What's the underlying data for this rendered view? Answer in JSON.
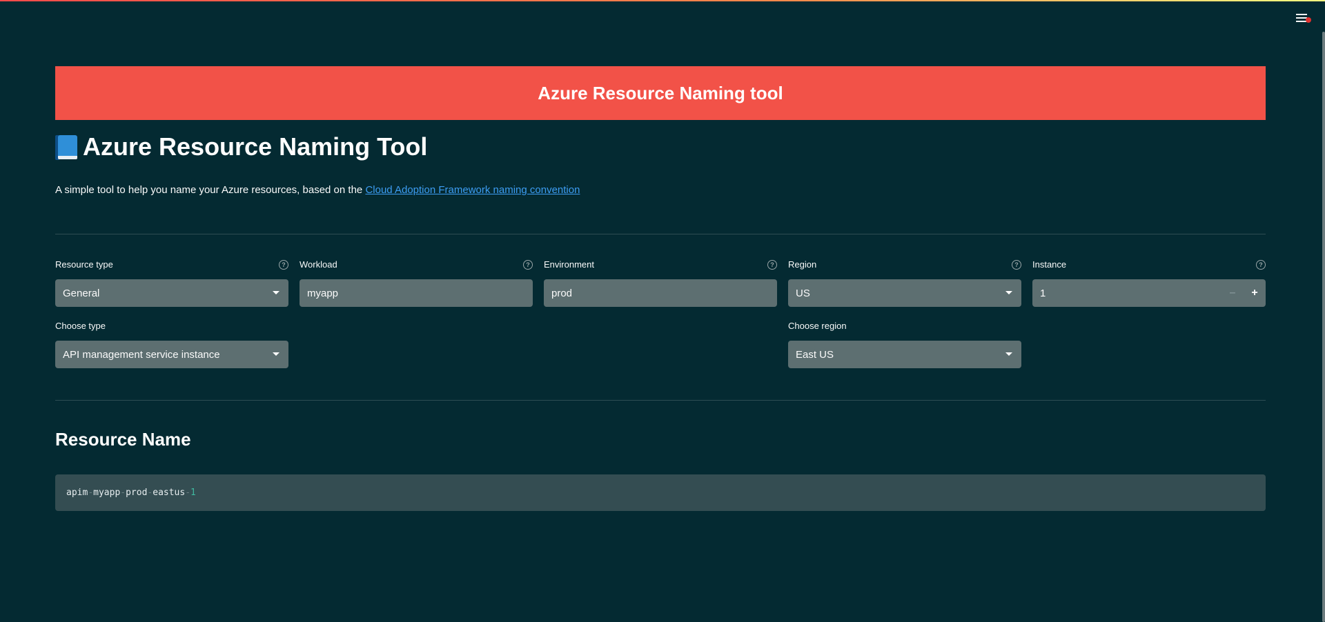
{
  "banner": {
    "text": "Azure Resource Naming tool"
  },
  "page": {
    "title": "Azure Resource Naming Tool",
    "title_icon": "book-icon",
    "subtitle_text": "A simple tool to help you name your Azure resources, based on the ",
    "subtitle_link": "Cloud Adoption Framework naming convention"
  },
  "fields": {
    "resource_type": {
      "label": "Resource type",
      "value": "General"
    },
    "workload": {
      "label": "Workload",
      "value": "myapp"
    },
    "environment": {
      "label": "Environment",
      "value": "prod"
    },
    "region": {
      "label": "Region",
      "value": "US"
    },
    "instance": {
      "label": "Instance",
      "value": "1",
      "minus": "–",
      "plus": "+"
    },
    "choose_type": {
      "label": "Choose type",
      "value": "API management service instance"
    },
    "choose_region": {
      "label": "Choose region",
      "value": "East US"
    }
  },
  "help_glyph": "?",
  "result": {
    "title": "Resource Name",
    "parts": [
      "apim",
      "myapp",
      "prod",
      "eastus",
      "1"
    ],
    "separator": "-"
  },
  "colors": {
    "background": "#042a32",
    "banner": "#f25248",
    "link": "#3d9df3",
    "input": "#5d6f71",
    "code_bg": "#344d52"
  }
}
